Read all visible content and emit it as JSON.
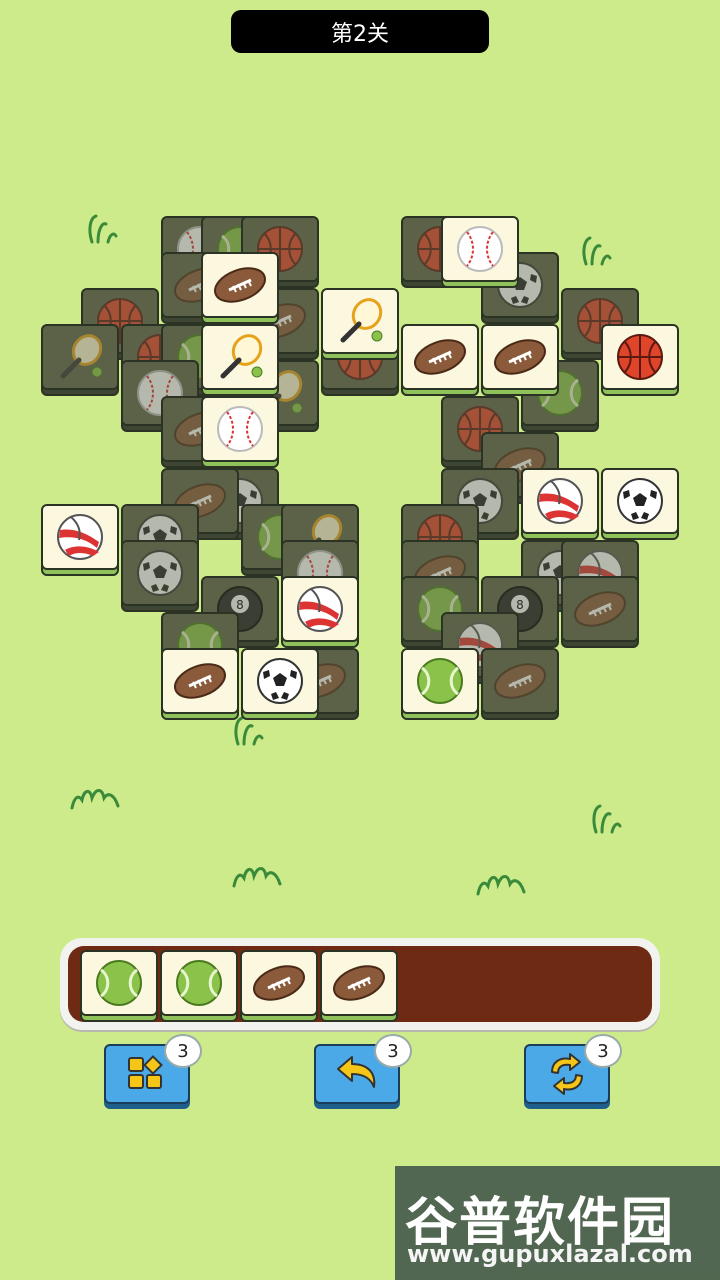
{
  "level": {
    "title": "第2关"
  },
  "colors": {
    "background": "#cdeb8b",
    "tray": "#6f2a14",
    "tool_button": "#4aa9e6",
    "tile_face": "#fbf8df",
    "tile_blocked": "#5b6248"
  },
  "board": {
    "tiles": [
      {
        "icon": "baseball-icon",
        "state": "blocked"
      },
      {
        "icon": "tennis-ball-icon",
        "state": "blocked"
      },
      {
        "icon": "basketball-icon",
        "state": "blocked"
      },
      {
        "icon": "football-icon",
        "state": "blocked"
      },
      {
        "icon": "football-icon",
        "state": "free"
      },
      {
        "icon": "basketball-icon",
        "state": "blocked"
      },
      {
        "icon": "football-icon",
        "state": "blocked"
      },
      {
        "icon": "tennis-racket-icon",
        "state": "free"
      },
      {
        "icon": "tennis-racket-icon",
        "state": "blocked"
      },
      {
        "icon": "basketball-icon",
        "state": "blocked"
      },
      {
        "icon": "tennis-ball-icon",
        "state": "blocked"
      },
      {
        "icon": "tennis-racket-icon",
        "state": "free"
      },
      {
        "icon": "football-icon",
        "state": "free"
      },
      {
        "icon": "basketball-icon",
        "state": "blocked"
      },
      {
        "icon": "baseball-icon",
        "state": "blocked"
      },
      {
        "icon": "baseball-icon",
        "state": "free"
      },
      {
        "icon": "tennis-racket-icon",
        "state": "blocked"
      },
      {
        "icon": "football-icon",
        "state": "blocked"
      },
      {
        "icon": "soccer-ball-icon",
        "state": "blocked"
      },
      {
        "icon": "volleyball-icon",
        "state": "free"
      },
      {
        "icon": "soccer-ball-icon",
        "state": "blocked"
      },
      {
        "icon": "soccer-ball-icon",
        "state": "blocked"
      },
      {
        "icon": "tennis-ball-icon",
        "state": "blocked"
      },
      {
        "icon": "baseball-icon",
        "state": "blocked"
      },
      {
        "icon": "tennis-racket-icon",
        "state": "blocked"
      },
      {
        "icon": "football-icon",
        "state": "blocked"
      },
      {
        "icon": "eight-ball-icon",
        "state": "blocked"
      },
      {
        "icon": "volleyball-icon",
        "state": "free"
      },
      {
        "icon": "tennis-ball-icon",
        "state": "blocked"
      },
      {
        "icon": "football-icon",
        "state": "free"
      },
      {
        "icon": "soccer-ball-icon",
        "state": "free"
      },
      {
        "icon": "football-icon",
        "state": "blocked"
      },
      {
        "icon": "baseball-icon",
        "state": "free"
      },
      {
        "icon": "basketball-icon",
        "state": "blocked"
      },
      {
        "icon": "soccer-ball-icon",
        "state": "blocked"
      },
      {
        "icon": "basketball-icon",
        "state": "blocked"
      },
      {
        "icon": "football-icon",
        "state": "free"
      },
      {
        "icon": "football-icon",
        "state": "free"
      },
      {
        "icon": "basketball-icon",
        "state": "free"
      },
      {
        "icon": "tennis-ball-icon",
        "state": "blocked"
      },
      {
        "icon": "football-icon",
        "state": "blocked"
      },
      {
        "icon": "soccer-ball-icon",
        "state": "blocked"
      },
      {
        "icon": "basketball-icon",
        "state": "blocked"
      },
      {
        "icon": "volleyball-icon",
        "state": "free"
      },
      {
        "icon": "soccer-ball-icon",
        "state": "free"
      },
      {
        "icon": "basketball-icon",
        "state": "blocked"
      },
      {
        "icon": "football-icon",
        "state": "blocked"
      },
      {
        "icon": "soccer-ball-icon",
        "state": "blocked"
      },
      {
        "icon": "volleyball-icon",
        "state": "blocked"
      },
      {
        "icon": "tennis-ball-icon",
        "state": "blocked"
      },
      {
        "icon": "eight-ball-icon",
        "state": "blocked"
      },
      {
        "icon": "football-icon",
        "state": "blocked"
      },
      {
        "icon": "volleyball-icon",
        "state": "blocked"
      },
      {
        "icon": "tennis-ball-icon",
        "state": "free"
      },
      {
        "icon": "football-icon",
        "state": "blocked"
      }
    ]
  },
  "tray": {
    "slots": [
      {
        "icon": "tennis-ball-icon"
      },
      {
        "icon": "tennis-ball-icon"
      },
      {
        "icon": "football-icon"
      },
      {
        "icon": "football-icon"
      }
    ]
  },
  "tools": [
    {
      "name": "shuffle-tool",
      "icon": "shapes-icon",
      "count": "3"
    },
    {
      "name": "undo-tool",
      "icon": "undo-arrow-icon",
      "count": "3"
    },
    {
      "name": "refresh-tool",
      "icon": "refresh-icon",
      "count": "3"
    }
  ],
  "watermark": {
    "title": "谷普软件园",
    "url": "www.gupuxlazal.com"
  }
}
